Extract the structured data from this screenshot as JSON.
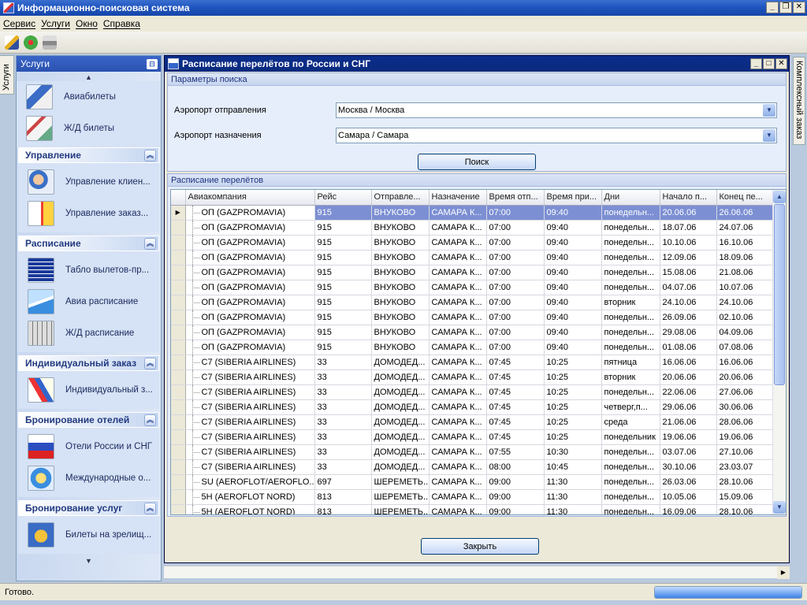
{
  "app": {
    "title": "Информационно-поисковая система"
  },
  "menu": [
    "Сервис",
    "Услуги",
    "Окно",
    "Справка"
  ],
  "left_tab": "Услуги",
  "right_tab": "Комплексный заказ",
  "sidebar": {
    "title": "Услуги",
    "top_items": [
      {
        "label": "Авиабилеты",
        "icon": "plane-ticket-icon"
      },
      {
        "label": "Ж/Д билеты",
        "icon": "rail-ticket-icon"
      }
    ],
    "groups": [
      {
        "title": "Управление",
        "items": [
          {
            "label": "Управление клиен...",
            "icon": "client-icon"
          },
          {
            "label": "Управление заказ...",
            "icon": "order-icon"
          }
        ]
      },
      {
        "title": "Расписание",
        "items": [
          {
            "label": "Табло вылетов-пр...",
            "icon": "departure-board-icon"
          },
          {
            "label": "Авиа расписание",
            "icon": "air-schedule-icon"
          },
          {
            "label": "Ж/Д расписание",
            "icon": "rail-schedule-icon"
          }
        ]
      },
      {
        "title": "Индивидуальный заказ",
        "items": [
          {
            "label": "Индивидуальный з...",
            "icon": "individual-order-icon"
          }
        ]
      },
      {
        "title": "Бронирование отелей",
        "items": [
          {
            "label": "Отели России и СНГ",
            "icon": "russia-hotels-icon"
          },
          {
            "label": "Международные о...",
            "icon": "international-hotels-icon"
          }
        ]
      },
      {
        "title": "Бронирование услуг",
        "items": [
          {
            "label": "Билеты на зрелищ...",
            "icon": "theatre-icon"
          }
        ]
      }
    ]
  },
  "child": {
    "title": "Расписание перелётов по России и СНГ",
    "search": {
      "header": "Параметры поиска",
      "from_label": "Аэропорт отправления",
      "from_value": "Москва / Москва",
      "to_label": "Аэропорт назначения",
      "to_value": "Самара / Самара",
      "search_button": "Поиск"
    },
    "grid": {
      "header": "Расписание перелётов",
      "columns": [
        "Авиакомпания",
        "Рейс",
        "Отправле...",
        "Назначение",
        "Время отп...",
        "Время при...",
        "Дни",
        "Начало п...",
        "Конец пе..."
      ],
      "selected_row": 0,
      "rows": [
        [
          "ОП (GAZPROMAVIA)",
          "915",
          "ВНУКОВО",
          "САМАРА К...",
          "07:00",
          "09:40",
          "понедельн...",
          "20.06.06",
          "26.06.06"
        ],
        [
          "ОП (GAZPROMAVIA)",
          "915",
          "ВНУКОВО",
          "САМАРА К...",
          "07:00",
          "09:40",
          "понедельн...",
          "18.07.06",
          "24.07.06"
        ],
        [
          "ОП (GAZPROMAVIA)",
          "915",
          "ВНУКОВО",
          "САМАРА К...",
          "07:00",
          "09:40",
          "понедельн...",
          "10.10.06",
          "16.10.06"
        ],
        [
          "ОП (GAZPROMAVIA)",
          "915",
          "ВНУКОВО",
          "САМАРА К...",
          "07:00",
          "09:40",
          "понедельн...",
          "12.09.06",
          "18.09.06"
        ],
        [
          "ОП (GAZPROMAVIA)",
          "915",
          "ВНУКОВО",
          "САМАРА К...",
          "07:00",
          "09:40",
          "понедельн...",
          "15.08.06",
          "21.08.06"
        ],
        [
          "ОП (GAZPROMAVIA)",
          "915",
          "ВНУКОВО",
          "САМАРА К...",
          "07:00",
          "09:40",
          "понедельн...",
          "04.07.06",
          "10.07.06"
        ],
        [
          "ОП (GAZPROMAVIA)",
          "915",
          "ВНУКОВО",
          "САМАРА К...",
          "07:00",
          "09:40",
          "вторник",
          "24.10.06",
          "24.10.06"
        ],
        [
          "ОП (GAZPROMAVIA)",
          "915",
          "ВНУКОВО",
          "САМАРА К...",
          "07:00",
          "09:40",
          "понедельн...",
          "26.09.06",
          "02.10.06"
        ],
        [
          "ОП (GAZPROMAVIA)",
          "915",
          "ВНУКОВО",
          "САМАРА К...",
          "07:00",
          "09:40",
          "понедельн...",
          "29.08.06",
          "04.09.06"
        ],
        [
          "ОП (GAZPROMAVIA)",
          "915",
          "ВНУКОВО",
          "САМАРА К...",
          "07:00",
          "09:40",
          "понедельн...",
          "01.08.06",
          "07.08.06"
        ],
        [
          "C7 (SIBERIA AIRLINES)",
          "33",
          "ДОМОДЕД...",
          "САМАРА К...",
          "07:45",
          "10:25",
          "пятница",
          "16.06.06",
          "16.06.06"
        ],
        [
          "C7 (SIBERIA AIRLINES)",
          "33",
          "ДОМОДЕД...",
          "САМАРА К...",
          "07:45",
          "10:25",
          "вторник",
          "20.06.06",
          "20.06.06"
        ],
        [
          "C7 (SIBERIA AIRLINES)",
          "33",
          "ДОМОДЕД...",
          "САМАРА К...",
          "07:45",
          "10:25",
          "понедельн...",
          "22.06.06",
          "27.06.06"
        ],
        [
          "C7 (SIBERIA AIRLINES)",
          "33",
          "ДОМОДЕД...",
          "САМАРА К...",
          "07:45",
          "10:25",
          "четверг,п...",
          "29.06.06",
          "30.06.06"
        ],
        [
          "C7 (SIBERIA AIRLINES)",
          "33",
          "ДОМОДЕД...",
          "САМАРА К...",
          "07:45",
          "10:25",
          "среда",
          "21.06.06",
          "28.06.06"
        ],
        [
          "C7 (SIBERIA AIRLINES)",
          "33",
          "ДОМОДЕД...",
          "САМАРА К...",
          "07:45",
          "10:25",
          "понедельник",
          "19.06.06",
          "19.06.06"
        ],
        [
          "C7 (SIBERIA AIRLINES)",
          "33",
          "ДОМОДЕД...",
          "САМАРА К...",
          "07:55",
          "10:30",
          "понедельн...",
          "03.07.06",
          "27.10.06"
        ],
        [
          "C7 (SIBERIA AIRLINES)",
          "33",
          "ДОМОДЕД...",
          "САМАРА К...",
          "08:00",
          "10:45",
          "понедельн...",
          "30.10.06",
          "23.03.07"
        ],
        [
          "SU (AEROFLOT/AEROFLO...",
          "697",
          "ШЕРЕМЕТЬ...",
          "САМАРА К...",
          "09:00",
          "11:30",
          "понедельн...",
          "26.03.06",
          "28.10.06"
        ],
        [
          "5H (AEROFLOT NORD)",
          "813",
          "ШЕРЕМЕТЬ...",
          "САМАРА К...",
          "09:00",
          "11:30",
          "понедельн...",
          "10.05.06",
          "15.09.06"
        ],
        [
          "5H (AEROFLOT NORD)",
          "813",
          "ШЕРЕМЕТЬ...",
          "САМАРА К...",
          "09:00",
          "11:30",
          "понедельн...",
          "16.09.06",
          "28.10.06"
        ]
      ]
    },
    "close_button": "Закрыть"
  },
  "status": {
    "text": "Готово.",
    "progress": 1.0
  }
}
